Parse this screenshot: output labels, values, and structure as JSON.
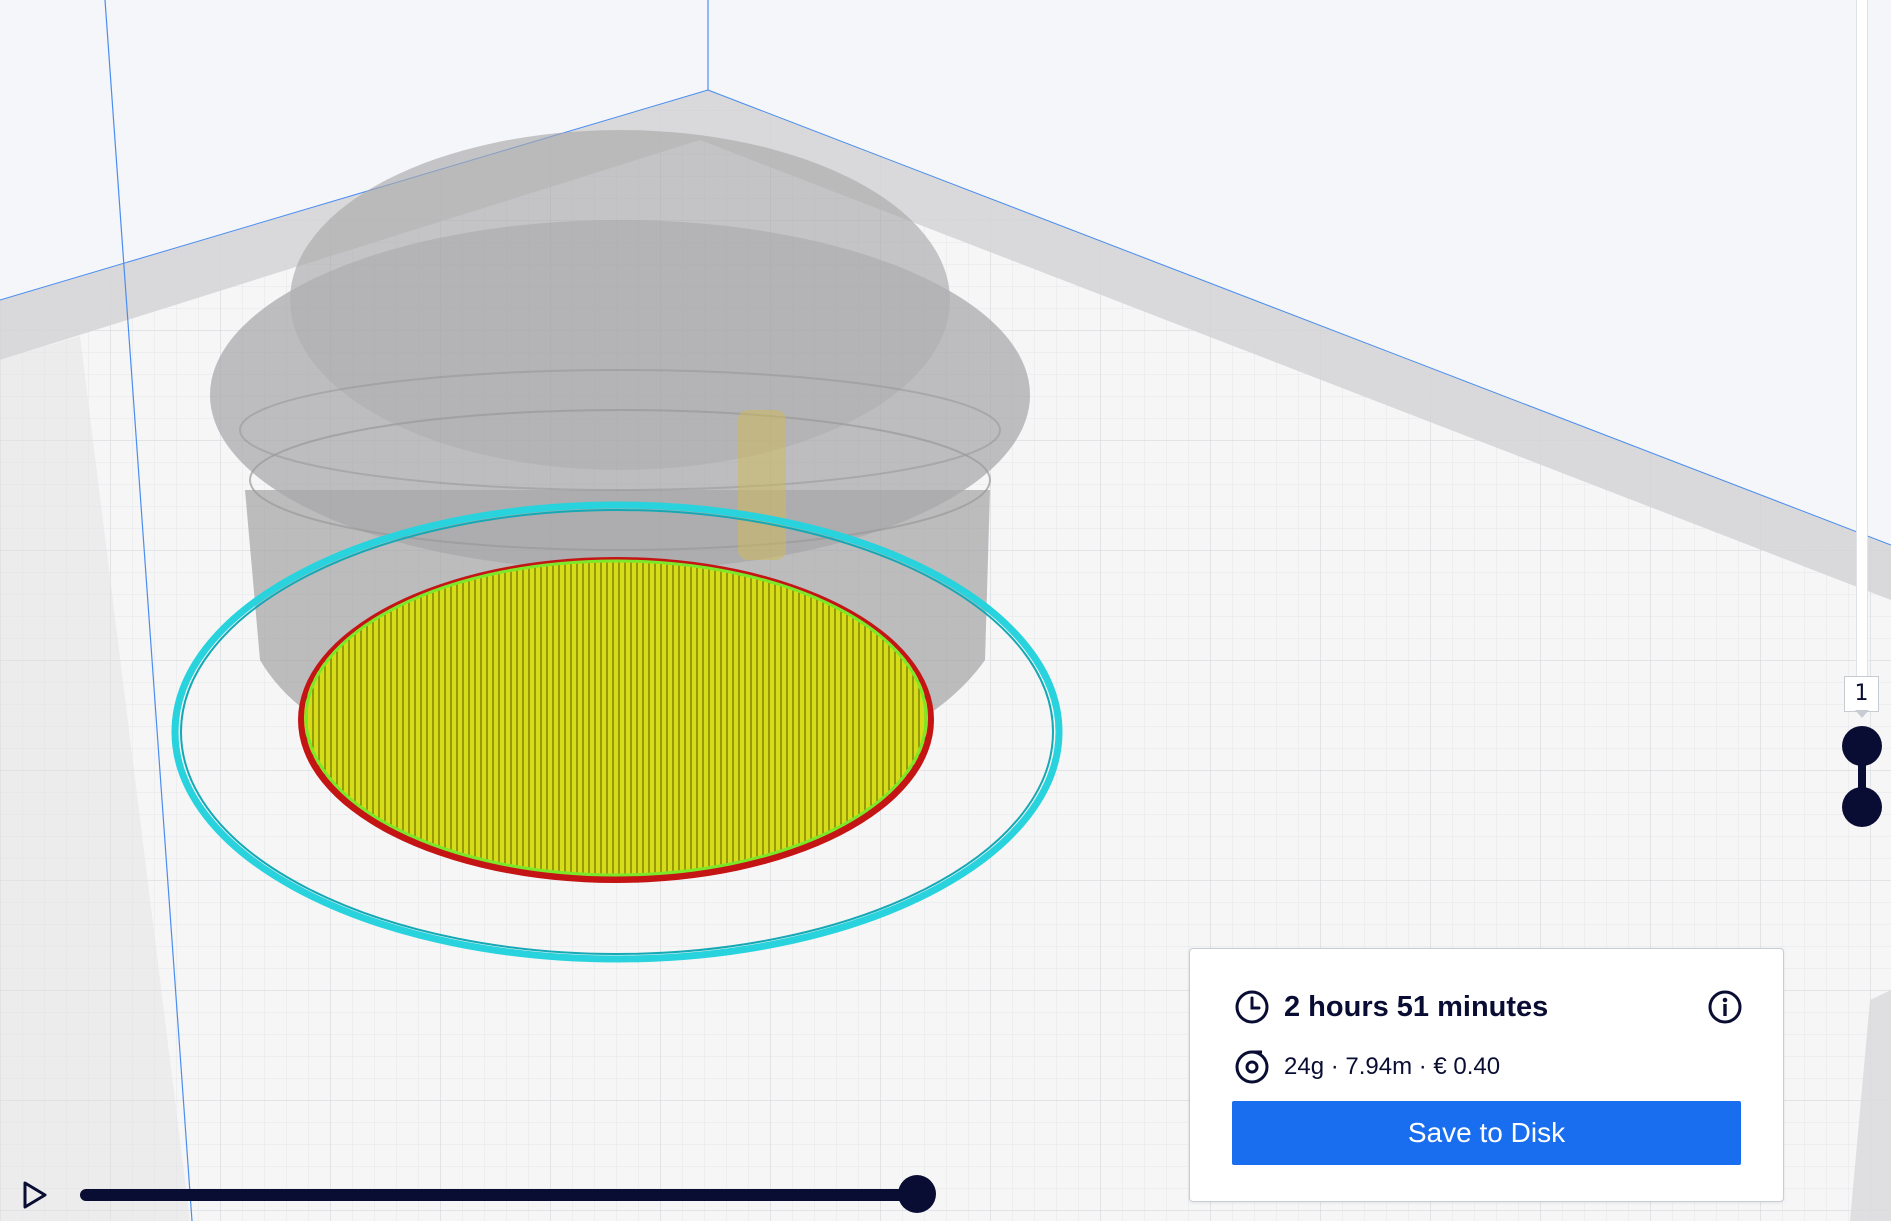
{
  "layer_view": {
    "current_layer_label": "1",
    "active_color": "#0a0d33"
  },
  "simulation": {
    "play_icon": "play-icon",
    "progress_fraction": 1.0
  },
  "print_info": {
    "time": "2 hours 51 minutes",
    "time_icon": "clock-icon",
    "info_icon": "info-icon",
    "material": "24g · 7.94m · € 0.40",
    "material_icon": "spool-icon",
    "save_label": "Save to Disk",
    "save_color": "#196ef0"
  },
  "scene_colors": {
    "skirt": "#29d3dd",
    "infill": "#d6dc18",
    "wall_outer": "#d01818",
    "wall_inner": "#7de82a",
    "model_shadow": "#9b9b9b",
    "build_volume_edge": "#4a8df0"
  }
}
